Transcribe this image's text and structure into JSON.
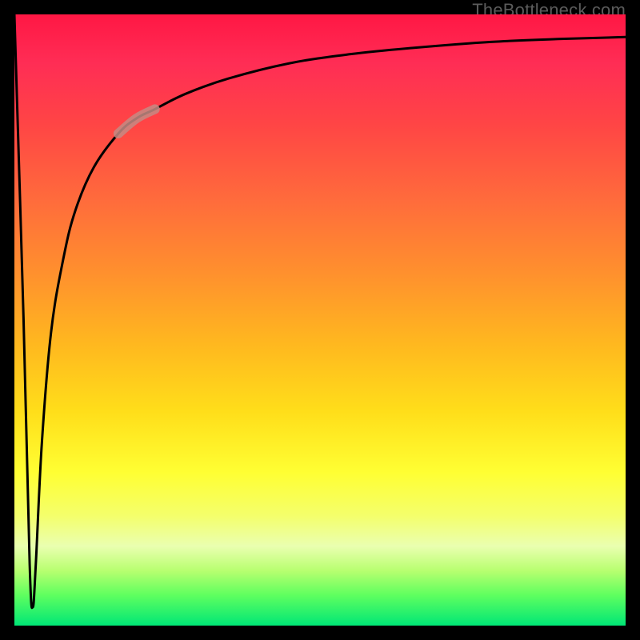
{
  "watermark": {
    "text": "TheBottleneck.com"
  },
  "chart_data": {
    "type": "line",
    "title": "",
    "xlabel": "",
    "ylabel": "",
    "ylim": [
      0,
      100
    ],
    "xlim": [
      0,
      100
    ],
    "background_gradient": "red-yellow-green vertical",
    "highlight_segment": {
      "x_start": 17,
      "x_end": 23,
      "color": "#c48b84"
    },
    "curve": {
      "description": "sharp spike dropping from top-left to bottom near x≈3, then rising asymptotically toward top-right",
      "x": [
        0,
        1.5,
        2.5,
        3,
        3.5,
        4.5,
        6,
        8,
        10,
        13,
        17,
        20,
        23,
        28,
        35,
        45,
        55,
        65,
        78,
        90,
        100
      ],
      "y": [
        100,
        50,
        10,
        3,
        10,
        30,
        48,
        60,
        68,
        75,
        80.5,
        83,
        84.5,
        87,
        89.5,
        92,
        93.5,
        94.5,
        95.5,
        96,
        96.3
      ]
    }
  }
}
